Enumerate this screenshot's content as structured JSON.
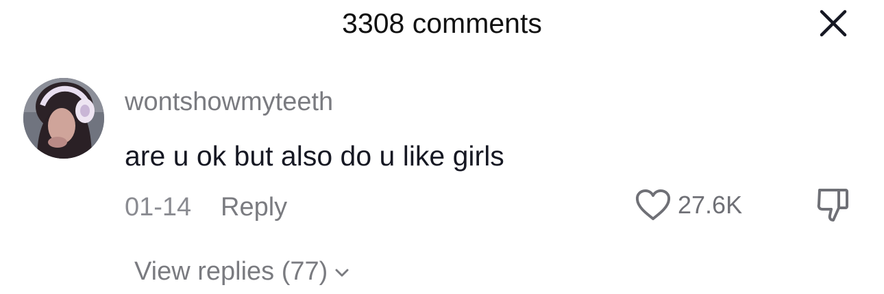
{
  "header": {
    "comments_count_label": "3308 comments"
  },
  "comment": {
    "username": "wontshowmyteeth",
    "text": "are u ok but also do u like girls",
    "date": "01-14",
    "reply_label": "Reply",
    "like_count": "27.6K",
    "view_replies_label": "View replies (77)"
  },
  "icons": {
    "close": "close-icon",
    "like": "heart-icon",
    "dislike": "thumbs-down-icon",
    "expand": "chevron-down-icon"
  },
  "colors": {
    "text_primary": "#161823",
    "text_secondary": "#7a7b80",
    "background": "#ffffff"
  }
}
